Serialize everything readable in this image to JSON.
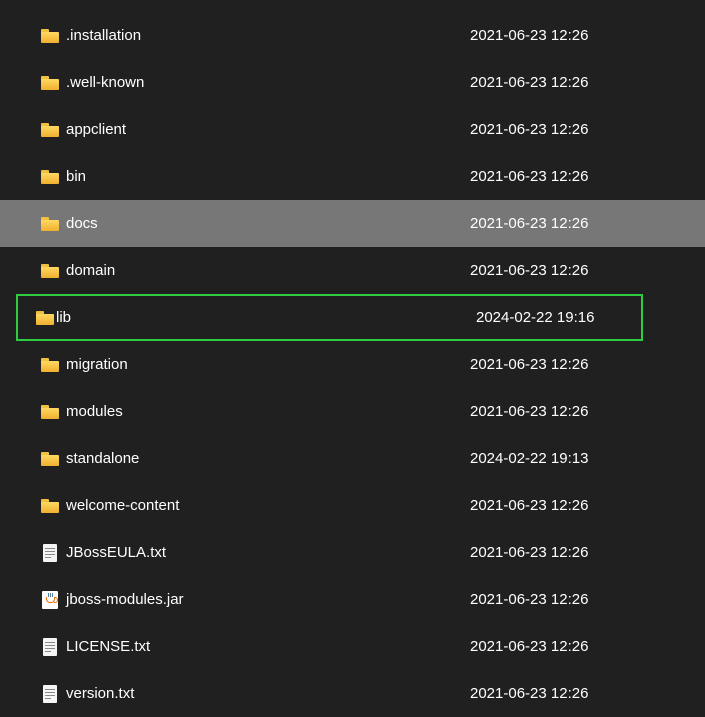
{
  "items": [
    {
      "name": ".installation",
      "date": "2021-06-23 12:26",
      "type": "folder",
      "selected": false,
      "highlighted": false
    },
    {
      "name": ".well-known",
      "date": "2021-06-23 12:26",
      "type": "folder",
      "selected": false,
      "highlighted": false
    },
    {
      "name": "appclient",
      "date": "2021-06-23 12:26",
      "type": "folder",
      "selected": false,
      "highlighted": false
    },
    {
      "name": "bin",
      "date": "2021-06-23 12:26",
      "type": "folder",
      "selected": false,
      "highlighted": false
    },
    {
      "name": "docs",
      "date": "2021-06-23 12:26",
      "type": "folder",
      "selected": true,
      "highlighted": false
    },
    {
      "name": "domain",
      "date": "2021-06-23 12:26",
      "type": "folder",
      "selected": false,
      "highlighted": false
    },
    {
      "name": "lib",
      "date": "2024-02-22 19:16",
      "type": "folder",
      "selected": false,
      "highlighted": true
    },
    {
      "name": "migration",
      "date": "2021-06-23 12:26",
      "type": "folder",
      "selected": false,
      "highlighted": false
    },
    {
      "name": "modules",
      "date": "2021-06-23 12:26",
      "type": "folder",
      "selected": false,
      "highlighted": false
    },
    {
      "name": "standalone",
      "date": "2024-02-22 19:13",
      "type": "folder",
      "selected": false,
      "highlighted": false
    },
    {
      "name": "welcome-content",
      "date": "2021-06-23 12:26",
      "type": "folder",
      "selected": false,
      "highlighted": false
    },
    {
      "name": "JBossEULA.txt",
      "date": "2021-06-23 12:26",
      "type": "text",
      "selected": false,
      "highlighted": false
    },
    {
      "name": "jboss-modules.jar",
      "date": "2021-06-23 12:26",
      "type": "jar",
      "selected": false,
      "highlighted": false
    },
    {
      "name": "LICENSE.txt",
      "date": "2021-06-23 12:26",
      "type": "text",
      "selected": false,
      "highlighted": false
    },
    {
      "name": "version.txt",
      "date": "2021-06-23 12:26",
      "type": "text",
      "selected": false,
      "highlighted": false
    }
  ]
}
